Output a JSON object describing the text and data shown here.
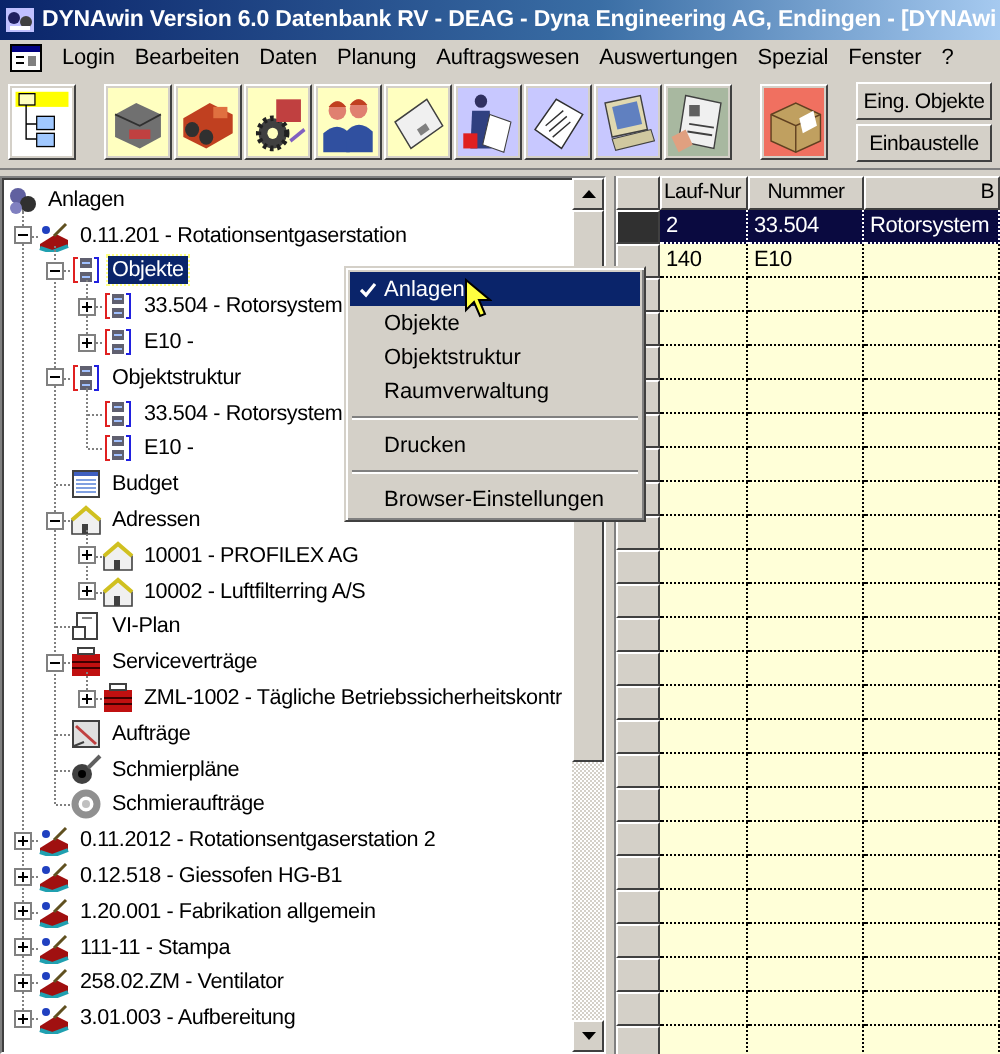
{
  "window": {
    "title": "DYNAwin Version 6.0 Datenbank RV - DEAG - Dyna Engineering AG, Endingen - [DYNAwi"
  },
  "menu": [
    "Login",
    "Bearbeiten",
    "Daten",
    "Planung",
    "Auftragswesen",
    "Auswertungen",
    "Spezial",
    "Fenster",
    "?"
  ],
  "toolbar": {
    "groups": [
      [
        {
          "kind": "tree"
        }
      ],
      [
        {
          "kind": "printer"
        },
        {
          "kind": "parts"
        },
        {
          "kind": "gear"
        },
        {
          "kind": "people"
        },
        {
          "kind": "letter"
        },
        {
          "kind": "courier"
        },
        {
          "kind": "documents"
        },
        {
          "kind": "computer"
        },
        {
          "kind": "form"
        }
      ],
      [
        {
          "kind": "box"
        }
      ]
    ],
    "text_buttons": [
      "Eing. Objekte",
      "Einbaustelle"
    ]
  },
  "tree": {
    "label": "Anlagen",
    "kind": "root",
    "selected": false,
    "children": [
      {
        "label": "0.11.201 - Rotationsentgaserstation",
        "kind": "plant",
        "expanded": true,
        "selected": false,
        "children": [
          {
            "label": "Objekte",
            "kind": "objects",
            "expanded": true,
            "selected": true,
            "children": [
              {
                "label": "33.504 - Rotorsystem",
                "kind": "objects",
                "expanded": false,
                "selected": false
              },
              {
                "label": "E10 -",
                "kind": "objects",
                "expanded": false,
                "selected": false
              }
            ]
          },
          {
            "label": "Objektstruktur",
            "kind": "objects",
            "expanded": true,
            "selected": false,
            "children": [
              {
                "label": "33.504 - Rotorsystem",
                "kind": "objects",
                "selected": false
              },
              {
                "label": "E10 -",
                "kind": "objects",
                "selected": false
              }
            ]
          },
          {
            "label": "Budget",
            "kind": "budget",
            "selected": false
          },
          {
            "label": "Adressen",
            "kind": "address",
            "expanded": true,
            "selected": false,
            "children": [
              {
                "label": "10001 - PROFILEX AG",
                "kind": "address",
                "expanded": false,
                "selected": false
              },
              {
                "label": "10002 - Luftfilterring A/S",
                "kind": "address",
                "expanded": false,
                "selected": false
              }
            ]
          },
          {
            "label": "VI-Plan",
            "kind": "plan",
            "selected": false
          },
          {
            "label": "Serviceverträge",
            "kind": "service",
            "expanded": true,
            "selected": false,
            "children": [
              {
                "label": "ZML-1002 - Tägliche Betriebssicherheitskontr",
                "kind": "service",
                "expanded": false,
                "selected": false
              }
            ]
          },
          {
            "label": "Aufträge",
            "kind": "orders",
            "selected": false
          },
          {
            "label": "Schmierpläne",
            "kind": "lube-plan",
            "selected": false
          },
          {
            "label": "Schmieraufträge",
            "kind": "lube-order",
            "selected": false
          }
        ]
      },
      {
        "label": "0.11.2012 - Rotationsentgaserstation 2",
        "kind": "plant",
        "expanded": false,
        "selected": false
      },
      {
        "label": "0.12.518 - Giessofen HG-B1",
        "kind": "plant",
        "expanded": false,
        "selected": false
      },
      {
        "label": "1.20.001 - Fabrikation allgemein",
        "kind": "plant",
        "expanded": false,
        "selected": false
      },
      {
        "label": "111-11 - Stampa",
        "kind": "plant",
        "expanded": false,
        "selected": false
      },
      {
        "label": "258.02.ZM - Ventilator",
        "kind": "plant",
        "expanded": false,
        "selected": false
      },
      {
        "label": "3.01.003 - Aufbereitung",
        "kind": "plant",
        "expanded": false,
        "selected": false
      }
    ]
  },
  "context_menu": {
    "items": [
      {
        "kind": "item",
        "label": "Anlagen",
        "checked": true,
        "selected": true
      },
      {
        "kind": "item",
        "label": "Objekte",
        "checked": false,
        "selected": false
      },
      {
        "kind": "item",
        "label": "Objektstruktur",
        "checked": false,
        "selected": false
      },
      {
        "kind": "item",
        "label": "Raumverwaltung",
        "checked": false,
        "selected": false
      },
      {
        "kind": "separator"
      },
      {
        "kind": "item",
        "label": "Drucken",
        "checked": false,
        "selected": false
      },
      {
        "kind": "separator"
      },
      {
        "kind": "item",
        "label": "Browser-Einstellungen",
        "checked": false,
        "selected": false
      }
    ]
  },
  "grid": {
    "columns": [
      "Lauf-Nur",
      "Nummer",
      "B"
    ],
    "rows": [
      {
        "cells": [
          "2",
          "33.504",
          "Rotorsystem"
        ],
        "selected": true
      },
      {
        "cells": [
          "140",
          "E10"
        ],
        "selected": false
      }
    ]
  }
}
